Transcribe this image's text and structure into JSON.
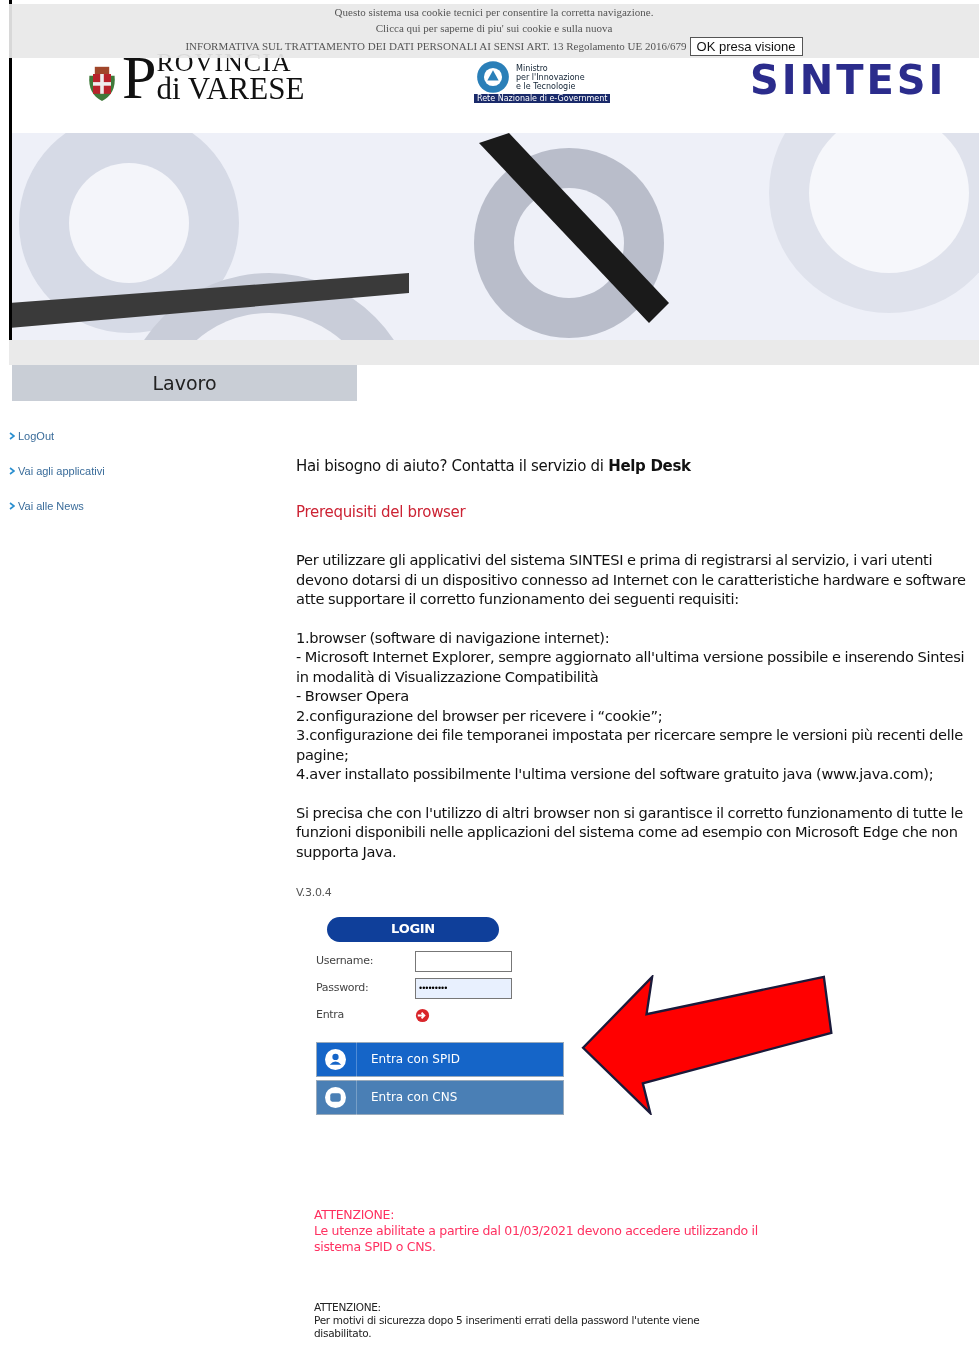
{
  "cookie_banner": {
    "lines": [
      "Questo sistema usa cookie tecnici per consentire la corretta navigazione.",
      "Clicca qui per saperne di piu' sui cookie e sulla nuova",
      "INFORMATIVA SUL TRATTAMENTO DEI DATI PERSONALI AI SENSI ART. 13 Regolamento UE 2016/679"
    ],
    "button": "OK presa visione"
  },
  "header": {
    "province_logo": {
      "initial": "P",
      "top": "ROVINCIA",
      "bottom": "di VARESE"
    },
    "ministry_logo": {
      "lines": [
        "Ministro",
        "per l'Innovazione",
        "e le Tecnologie"
      ],
      "band": "Rete Nazionale di e-Government"
    },
    "brand_logo": "SINTESI"
  },
  "tabs": [
    {
      "label": "Lavoro",
      "selected": true
    }
  ],
  "sidebar": {
    "links": [
      "LogOut",
      "Vai agli applicativi",
      "Vai alle News"
    ]
  },
  "help": "Hai bisogno di aiuto?  Contatta il servizio di **Help Desk**",
  "prerequisites": {
    "title": "Prerequisiti del browser",
    "intro": "Per utilizzare gli applicativi del sistema SINTESI e prima di registrarsi al servizio, i vari utenti devono dotarsi di un dispositivo connesso ad Internet con le caratteristiche hardware e software atte supportare il corretto funzionamento dei seguenti requisiti:",
    "items": [
      "1.browser (software di navigazione internet):",
      "- Microsoft Internet Explorer, sempre aggiornato all'ultima versione possibile e inserendo Sintesi in modalità di Visualizzazione Compatibilità",
      "- Browser Opera",
      "2.configurazione del browser per ricevere i “cookie”;",
      "3.configurazione dei file temporanei impostata per ricercare sempre le versioni più recenti delle pagine;",
      "4.aver installato possibilmente l'ultima versione del software gratuito java (www.java.com);"
    ],
    "note": "Si precisa che con l'utilizzo di altri browser non si garantisce il corretto funzionamento di tutte le funzioni disponibili nelle applicazioni del sistema come ad esempio con Microsoft Edge che non supporta Java."
  },
  "version": "V.3.0.4",
  "login": {
    "title": "LOGIN",
    "fields": [
      {
        "label": "Username:",
        "kind": "text"
      },
      {
        "label": "Password:",
        "kind": "password",
        "value": "•••••••••"
      }
    ],
    "submit_label": "Entra",
    "providers": [
      {
        "label": "Entra con SPID",
        "kind": "spid"
      },
      {
        "label": "Entra con CNS",
        "kind": "cns"
      }
    ]
  },
  "notices": [
    {
      "kind": "warning",
      "title": "ATTENZIONE:",
      "text": "Le utenze abilitate a partire dal 01/03/2021 devono accedere utilizzando il sistema SPID o CNS."
    },
    {
      "kind": "info",
      "title": "ATTENZIONE:",
      "text": "Per motivi di sicurezza dopo 5 inserimenti errati della password l'utente viene disabilitato."
    }
  ]
}
